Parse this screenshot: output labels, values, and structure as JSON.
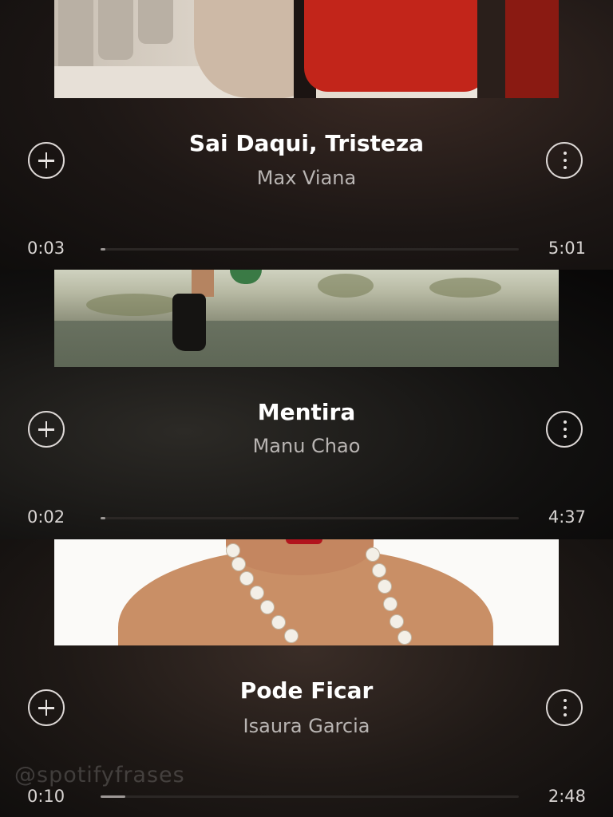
{
  "tracks": [
    {
      "title": "Sai Daqui, Tristeza",
      "artist": "Max Viana",
      "elapsed": "0:03",
      "duration": "5:01",
      "progress": 0.01
    },
    {
      "title": "Mentira",
      "artist": "Manu Chao",
      "elapsed": "0:02",
      "duration": "4:37",
      "progress": 0.007
    },
    {
      "title": "Pode Ficar",
      "artist": "Isaura Garcia",
      "elapsed": "0:10",
      "duration": "2:48",
      "progress": 0.06
    }
  ],
  "watermark": "@spotifyfrases",
  "icons": {
    "add": "plus-circle-icon",
    "more": "vertical-dots-icon"
  },
  "colors": {
    "background": "#1a1716",
    "text_primary": "#ffffff",
    "text_secondary": "#b9b5b3",
    "progress_fill": "#9d9896"
  }
}
